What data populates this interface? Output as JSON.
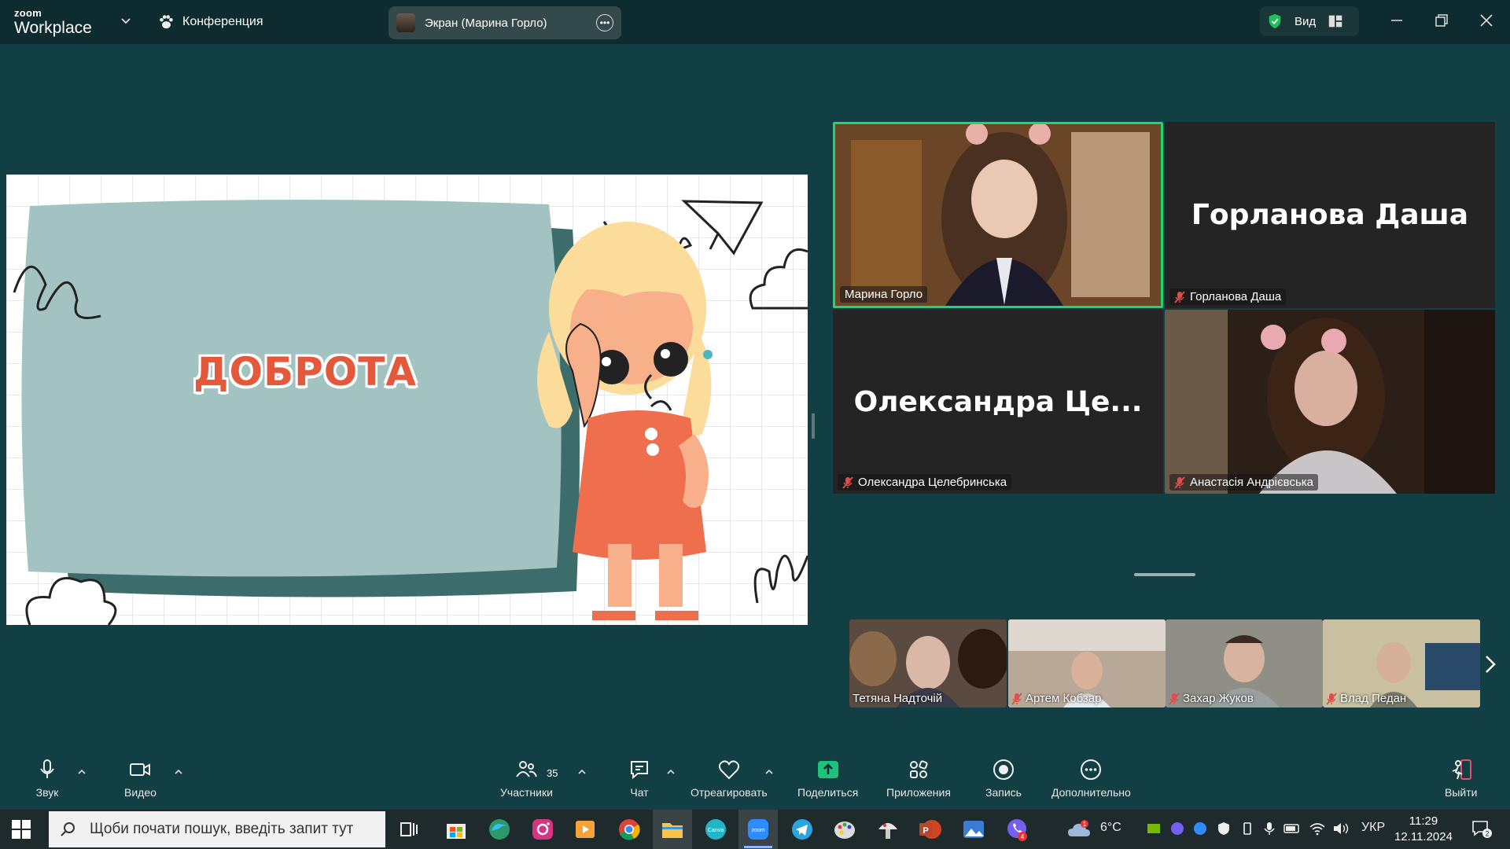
{
  "topbar": {
    "brand_small": "zoom",
    "brand_name": "Workplace",
    "meeting_label": "Конференция",
    "screen_share_label": "Экран (Марина Горло)",
    "view_label": "Вид"
  },
  "slide": {
    "title": "ДОБРОТА"
  },
  "video_tiles": [
    {
      "name": "Марина Горло",
      "muted": false,
      "active_speaker": true
    },
    {
      "name": "Горланова Даша",
      "big_name": "Горланова Даша",
      "muted": true
    },
    {
      "name": "Олександра Целебринська",
      "big_name": "Олександра  Це...",
      "muted": true
    },
    {
      "name": "Анастасія Андрієвська",
      "muted": true
    }
  ],
  "thumbnails": [
    {
      "name": "Тетяна Надточій",
      "muted": false
    },
    {
      "name": "Артем Кобзар",
      "muted": true
    },
    {
      "name": "Захар Жуков",
      "muted": true
    },
    {
      "name": "Влад Педан",
      "muted": true
    }
  ],
  "toolbar": {
    "audio": "Звук",
    "video": "Видео",
    "participants": "Участники",
    "participants_count": "35",
    "chat": "Чат",
    "react": "Отреагировать",
    "share": "Поделиться",
    "apps": "Приложения",
    "record": "Запись",
    "more": "Дополнительно",
    "leave": "Выйти"
  },
  "taskbar": {
    "search_placeholder": "Щоби почати пошук, введіть запит тут",
    "weather": "6°C",
    "weather_badge": "1",
    "language": "УКР",
    "time": "11:29",
    "date": "12.11.2024",
    "viber_badge": "4",
    "notifications_count": "2"
  },
  "colors": {
    "background": "#113f44",
    "topbar": "#0e2b2f",
    "active_speaker_border": "#23d36e",
    "share_button": "#1ec27a",
    "leave_icon": "#e0506a",
    "slide_title": "#e4593c"
  }
}
